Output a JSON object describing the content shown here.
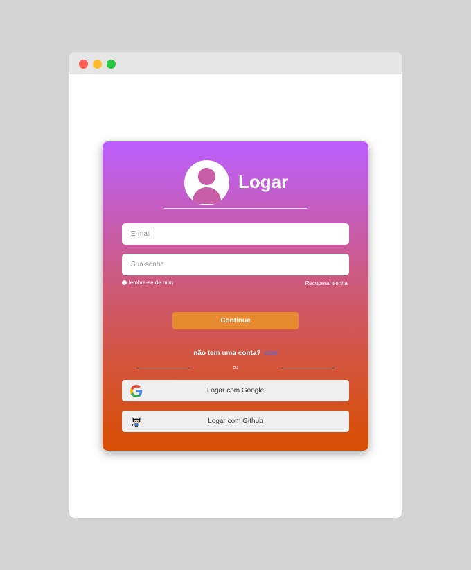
{
  "login": {
    "title": "Logar",
    "email_placeholder": "E-mail",
    "password_placeholder": "Sua senha",
    "remember_label": "lembre-se de mim",
    "recover_label": "Recuperar senha",
    "continue_label": "Continue",
    "no_account_text": "não tem uma conta?",
    "create_link": "criar",
    "or_text": "ou",
    "google_label": "Logar com Google",
    "github_label": "Logar com Github"
  },
  "colors": {
    "gradient_top": "#bc5fff",
    "gradient_bottom": "#d84e02",
    "continue_button": "#e88a2f",
    "link": "#3b6dff"
  },
  "icons": [
    "user-avatar-icon",
    "google-icon",
    "github-octocat-icon"
  ]
}
